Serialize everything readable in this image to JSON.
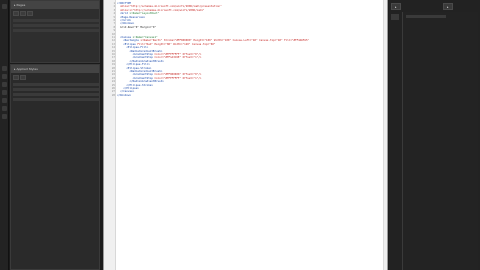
{
  "panels": {
    "pages_title": "▸ Pages",
    "applied_title": "▸ Applied Styles"
  },
  "right": {
    "tab1": "▸",
    "tab2": "▸"
  },
  "code": {
    "lines": [
      {
        "n": "1",
        "segs": [
          {
            "c": "tag",
            "t": "<!DOCTYPE"
          }
        ]
      },
      {
        "n": "2",
        "segs": [
          {
            "c": "atn",
            "t": "  xmlns=\"http://schemas.microsoft.com/winfx/2006/xaml/presentation\""
          }
        ]
      },
      {
        "n": "3",
        "segs": [
          {
            "c": "atn",
            "t": "  xmlns:x=\"http://schemas.microsoft.com/winfx/2006/xaml\""
          }
        ]
      },
      {
        "n": "4",
        "segs": [
          {
            "c": "tag",
            "t": "  <Grid "
          },
          {
            "c": "atv",
            "t": "x:Name=\"LayoutRoot\""
          }
        ]
      },
      {
        "n": "5",
        "segs": [
          {
            "c": "tag",
            "t": "  <Page.Resources>"
          }
        ]
      },
      {
        "n": "6",
        "segs": [
          {
            "c": "tag",
            "t": "  </Grid>"
          }
        ]
      },
      {
        "n": "7",
        "segs": [
          {
            "c": "tag",
            "t": "  </Window>"
          }
        ]
      },
      {
        "n": "8",
        "segs": [
          {
            "c": "txt",
            "t": "  Grid.Row=\"0\" Margin=\"0\""
          }
        ]
      },
      {
        "n": "9",
        "segs": [
          {
            "c": "txt",
            "t": ""
          }
        ]
      },
      {
        "n": "10",
        "segs": [
          {
            "c": "txt",
            "t": ""
          }
        ]
      },
      {
        "n": "11",
        "segs": [
          {
            "c": "tag",
            "t": "  <Canvas "
          },
          {
            "c": "atv",
            "t": "x:Name=\"Canvas1\""
          }
        ]
      },
      {
        "n": "12",
        "segs": [
          {
            "c": "tag",
            "t": "    <Rectangle "
          },
          {
            "c": "atn",
            "t": "x:Name=\"Rect1\" Stroke=\"#FF000000\" Height=\"100\" Width=\"100\" Canvas.Left=\"40\" Canvas.Top=\"40\" Fill=\"#FF4A6FA5\""
          }
        ]
      },
      {
        "n": "13",
        "segs": [
          {
            "c": "tag",
            "t": "    <Ellipse "
          },
          {
            "c": "atn",
            "t": "Fill=\"Red\" Height=\"80\" Width=\"120\" Canvas.Top=\"60\""
          }
        ]
      },
      {
        "n": "14",
        "segs": [
          {
            "c": "tag",
            "t": "      <Ellipse.Fill>"
          }
        ]
      },
      {
        "n": "15",
        "segs": [
          {
            "c": "tag",
            "t": "        <RadialGradientBrush>"
          }
        ]
      },
      {
        "n": "16",
        "segs": [
          {
            "c": "tag",
            "t": "          <GradientStop "
          },
          {
            "c": "atn",
            "t": "Color=\"#FFFFFFFF\" Offset=\"0\"/>"
          }
        ]
      },
      {
        "n": "17",
        "segs": [
          {
            "c": "tag",
            "t": "          <GradientStop "
          },
          {
            "c": "atn",
            "t": "Color=\"#FF1A3C6E\" Offset=\"1\"/>"
          }
        ]
      },
      {
        "n": "18",
        "segs": [
          {
            "c": "tag",
            "t": "        </RadialGradientBrush>"
          }
        ]
      },
      {
        "n": "19",
        "segs": [
          {
            "c": "tag",
            "t": "      </Ellipse.Fill>"
          }
        ]
      },
      {
        "n": "20",
        "segs": [
          {
            "c": "tag",
            "t": "      <Ellipse.Stroke>"
          }
        ]
      },
      {
        "n": "21",
        "segs": [
          {
            "c": "tag",
            "t": "        <RadialGradientBrush>"
          }
        ]
      },
      {
        "n": "22",
        "segs": [
          {
            "c": "tag",
            "t": "          <GradientStop "
          },
          {
            "c": "atn",
            "t": "Color=\"#FF000000\" Offset=\"0\"/>"
          }
        ]
      },
      {
        "n": "23",
        "segs": [
          {
            "c": "tag",
            "t": "          <GradientStop "
          },
          {
            "c": "atn",
            "t": "Color=\"#FFFFFFFF\" Offset=\"1\"/>"
          }
        ]
      },
      {
        "n": "24",
        "segs": [
          {
            "c": "tag",
            "t": "        </RadialGradientBrush>"
          }
        ]
      },
      {
        "n": "25",
        "segs": [
          {
            "c": "tag",
            "t": "      </Ellipse.Stroke>"
          }
        ]
      },
      {
        "n": "26",
        "segs": [
          {
            "c": "tag",
            "t": "    </Ellipse>"
          }
        ]
      },
      {
        "n": "27",
        "segs": [
          {
            "c": "tag",
            "t": "  </Canvas>"
          }
        ]
      },
      {
        "n": "28",
        "segs": [
          {
            "c": "tag",
            "t": "</Window>"
          }
        ]
      }
    ]
  }
}
